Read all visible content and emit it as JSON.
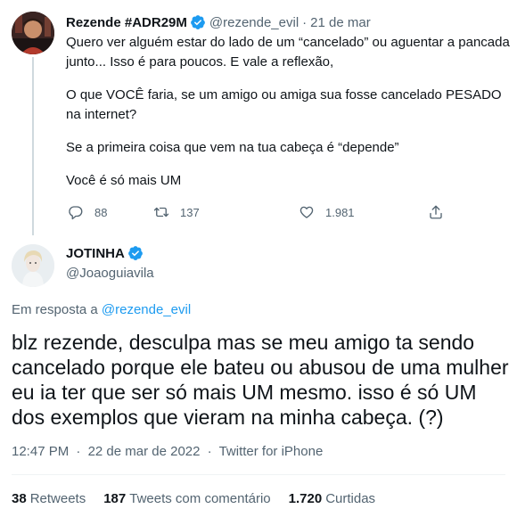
{
  "parent_tweet": {
    "display_name": "Rezende #ADR29M",
    "handle": "@rezende_evil",
    "separator": "·",
    "date": "21 de mar",
    "paragraphs": [
      "Quero ver alguém estar do lado de um “cancelado” ou aguentar a pancada junto... Isso é para poucos. E vale a reflexão,",
      "O que VOCÊ faria, se um amigo ou amiga sua fosse cancelado PESADO na internet?",
      "Se a primeira coisa que vem na tua cabeça é “depende”",
      "Você é só mais UM"
    ],
    "actions": {
      "reply_icon": "reply-icon",
      "reply_count": "88",
      "retweet_icon": "retweet-icon",
      "retweet_count": "137",
      "like_icon": "like-icon",
      "like_count": "1.981",
      "share_icon": "share-icon"
    }
  },
  "reply_tweet": {
    "display_name": "JOTINHA",
    "handle": "@Joaoguiavila",
    "in_reply_prefix": "Em resposta a",
    "in_reply_mention": "@rezende_evil",
    "text": "blz rezende, desculpa mas se meu amigo ta sendo cancelado porque ele bateu ou abusou de uma mulher eu ia ter que ser só mais UM mesmo. isso é só UM dos exemplos que vieram na minha cabeça. (?)",
    "time": "12:47 PM",
    "separator": "·",
    "date": "22 de mar de 2022",
    "source": "Twitter for iPhone",
    "stats": {
      "retweets_count": "38",
      "retweets_label": "Retweets",
      "quotes_count": "187",
      "quotes_label": "Tweets com comentário",
      "likes_count": "1.720",
      "likes_label": "Curtidas"
    }
  },
  "colors": {
    "text": "#0f1419",
    "secondary": "#536471",
    "accent": "#1d9bf0",
    "thread_line": "#cfd9de"
  }
}
